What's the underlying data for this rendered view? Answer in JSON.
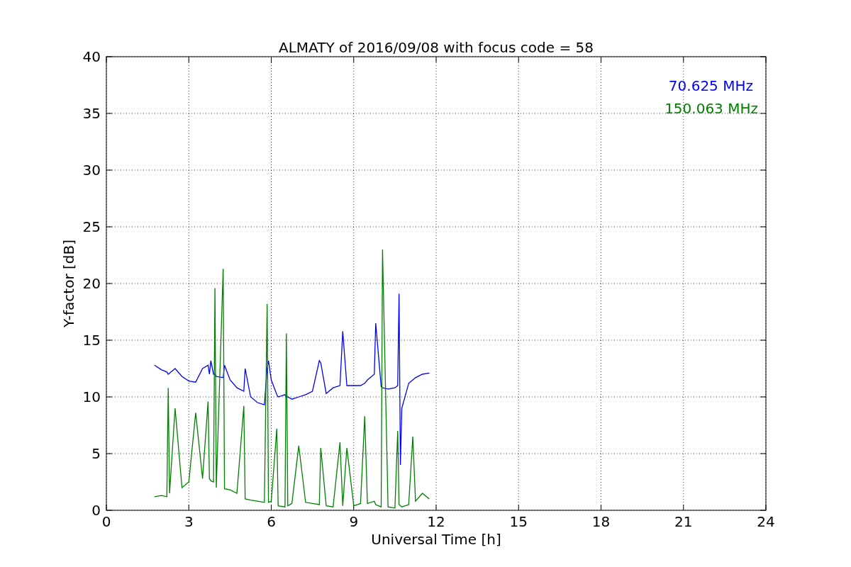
{
  "chart_data": {
    "type": "line",
    "title": "ALMATY of 2016/09/08 with focus code = 58",
    "xlabel": "Universal Time [h]",
    "ylabel": "Y-factor [dB]",
    "x": [
      1.75,
      2.0,
      2.2,
      2.25,
      2.3,
      2.5,
      2.75,
      3.0,
      3.25,
      3.5,
      3.7,
      3.75,
      3.8,
      3.9,
      3.95,
      4.0,
      4.25,
      4.3,
      4.5,
      4.75,
      5.0,
      5.05,
      5.25,
      5.5,
      5.75,
      5.85,
      5.9,
      6.0,
      6.2,
      6.25,
      6.5,
      6.55,
      6.6,
      6.75,
      7.0,
      7.25,
      7.5,
      7.75,
      7.8,
      8.0,
      8.25,
      8.5,
      8.6,
      8.75,
      9.0,
      9.25,
      9.4,
      9.5,
      9.75,
      9.8,
      10.0,
      10.05,
      10.25,
      10.5,
      10.6,
      10.65,
      10.7,
      10.75,
      11.0,
      11.15,
      11.25,
      11.5,
      11.75
    ],
    "series": [
      {
        "name": "70.625 MHz",
        "color": "#0000ff",
        "values": [
          12.8,
          12.4,
          12.2,
          12.0,
          12.1,
          12.5,
          11.8,
          11.4,
          11.3,
          12.5,
          12.8,
          12.0,
          13.2,
          12.0,
          12.0,
          11.8,
          11.7,
          12.8,
          11.5,
          10.8,
          10.5,
          12.5,
          10.0,
          9.5,
          9.3,
          12.5,
          13.2,
          11.5,
          10.2,
          10.0,
          10.2,
          10.0,
          10.0,
          9.8,
          10.0,
          10.2,
          10.5,
          13.2,
          13.0,
          10.3,
          10.8,
          11.0,
          15.8,
          11.0,
          11.0,
          11.0,
          11.2,
          11.5,
          12.0,
          16.5,
          10.9,
          10.8,
          10.7,
          10.8,
          11.0,
          19.1,
          4.0,
          9.0,
          11.2,
          11.5,
          11.7,
          12.0,
          12.1
        ]
      },
      {
        "name": "150.063 MHz",
        "color": "#008000",
        "values": [
          1.2,
          1.3,
          1.2,
          10.8,
          1.5,
          9.0,
          2.0,
          2.5,
          8.6,
          2.8,
          9.6,
          2.8,
          2.6,
          2.5,
          19.6,
          2.0,
          21.3,
          1.9,
          1.8,
          1.5,
          9.2,
          1.0,
          0.9,
          0.8,
          0.7,
          18.2,
          0.7,
          0.8,
          7.2,
          0.4,
          0.3,
          15.6,
          0.4,
          0.6,
          5.7,
          0.7,
          0.6,
          0.5,
          5.5,
          0.4,
          0.3,
          6.0,
          0.4,
          5.5,
          0.4,
          0.6,
          8.3,
          0.6,
          0.8,
          0.5,
          0.3,
          23.0,
          0.3,
          0.2,
          7.0,
          0.5,
          0.4,
          0.3,
          0.5,
          6.5,
          0.8,
          1.5,
          1.0
        ]
      }
    ],
    "xlim": [
      0,
      24
    ],
    "ylim": [
      0,
      40
    ],
    "xticks": [
      0,
      3,
      6,
      9,
      12,
      15,
      18,
      21,
      24
    ],
    "yticks": [
      0,
      5,
      10,
      15,
      20,
      25,
      30,
      35,
      40
    ],
    "grid": true
  }
}
